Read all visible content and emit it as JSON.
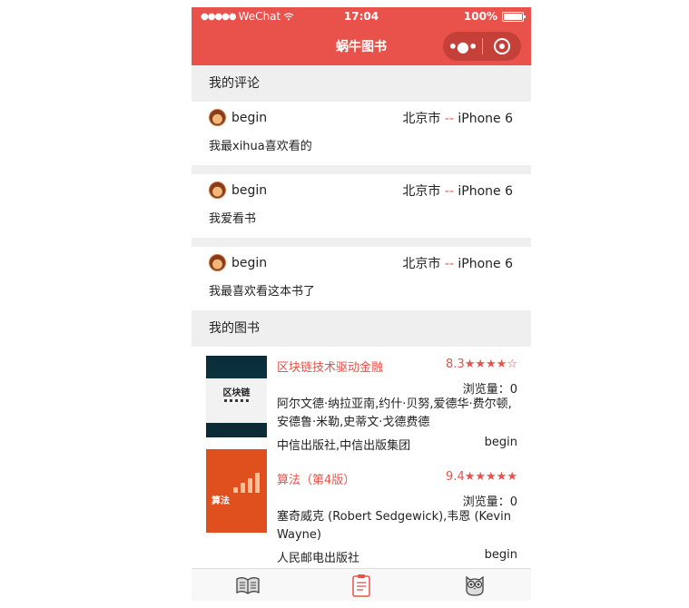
{
  "status_bar": {
    "carrier": "WeChat",
    "time": "17:04",
    "battery": "100%"
  },
  "nav": {
    "title": "蜗牛图书",
    "more_icon": "more-dots-icon",
    "close_icon": "target-circle-icon"
  },
  "sections": {
    "comments_header": "我的评论",
    "books_header": "我的图书"
  },
  "comments": [
    {
      "user": "begin",
      "city": "北京市",
      "separator": "--",
      "device": "iPhone 6",
      "text": "我最xihua喜欢看的"
    },
    {
      "user": "begin",
      "city": "北京市",
      "separator": "--",
      "device": "iPhone 6",
      "text": "我爱看书"
    },
    {
      "user": "begin",
      "city": "北京市",
      "separator": "--",
      "device": "iPhone 6",
      "text": "我最喜欢看这本书了"
    }
  ],
  "books": [
    {
      "title": "区块链技术驱动金融",
      "rating": "8.3★★★★☆",
      "views": "浏览量：0",
      "author": "阿尔文德·纳拉亚南,约什·贝努,爱德华·费尔顿,安德鲁·米勒,史蒂文·戈德费德",
      "publisher": "中信出版社,中信出版集团",
      "owner": "begin",
      "cover_title": "区块链"
    },
    {
      "title": "算法（第4版）",
      "rating": "9.4★★★★★",
      "views": "浏览量：0",
      "author": "塞奇威克 (Robert Sedgewick),韦恩 (Kevin Wayne)",
      "publisher": "人民邮电出版社",
      "owner": "begin",
      "cover_title": "算法"
    }
  ],
  "tabs": [
    {
      "icon": "book-icon"
    },
    {
      "icon": "clipboard-icon"
    },
    {
      "icon": "owl-icon"
    }
  ],
  "colors": {
    "accent": "#e9524b",
    "section_bg": "#efefef"
  }
}
